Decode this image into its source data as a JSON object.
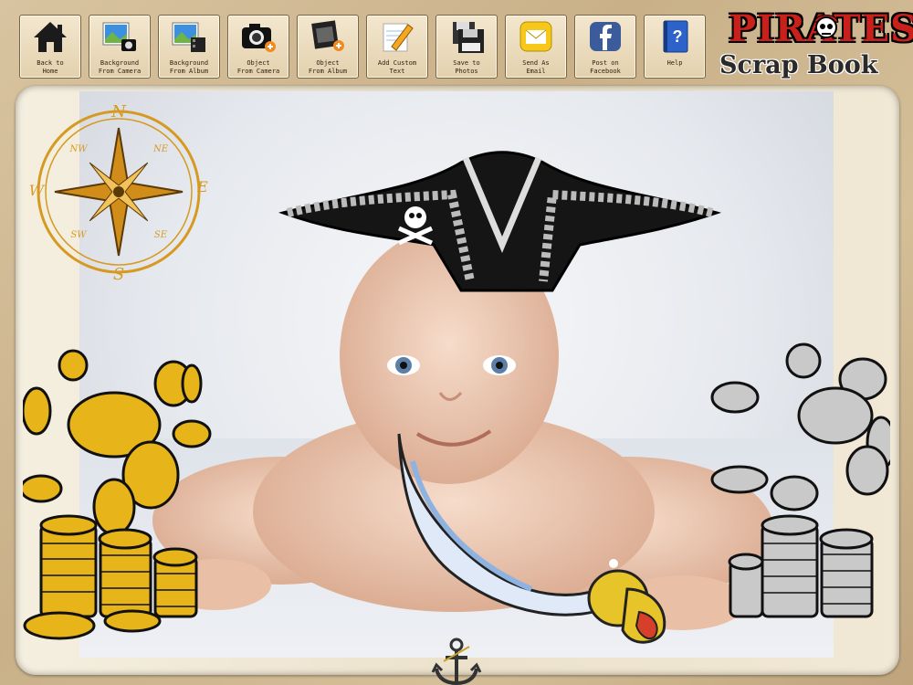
{
  "toolbar": {
    "buttons": [
      {
        "label": "Back to\nHome",
        "icon": "home-icon"
      },
      {
        "label": "Background\nFrom Camera",
        "icon": "photo-camera-icon"
      },
      {
        "label": "Background\nFrom Album",
        "icon": "photo-album-icon"
      },
      {
        "label": "Object\nFrom Camera",
        "icon": "camera-add-icon"
      },
      {
        "label": "Object\nFrom Album",
        "icon": "film-add-icon"
      },
      {
        "label": "Add Custom\nText",
        "icon": "notepad-pencil-icon"
      },
      {
        "label": "Save to\nPhotos",
        "icon": "floppy-disk-icon"
      },
      {
        "label": "Send As\nEmail",
        "icon": "envelope-icon"
      },
      {
        "label": "Post on\nFacebook",
        "icon": "facebook-icon"
      },
      {
        "label": "Help",
        "icon": "help-book-icon"
      }
    ]
  },
  "logo": {
    "line1": "PIRATES",
    "line2": "Scrap Book"
  },
  "compass": {
    "n": "N",
    "s": "S",
    "e": "E",
    "w": "W",
    "ne": "NE",
    "nw": "NW",
    "se": "SE",
    "sw": "SW"
  },
  "colors": {
    "accent_red": "#c8211c",
    "gold": "#e7b419",
    "silver": "#b7b7b7",
    "wood": "#cdb68f"
  }
}
